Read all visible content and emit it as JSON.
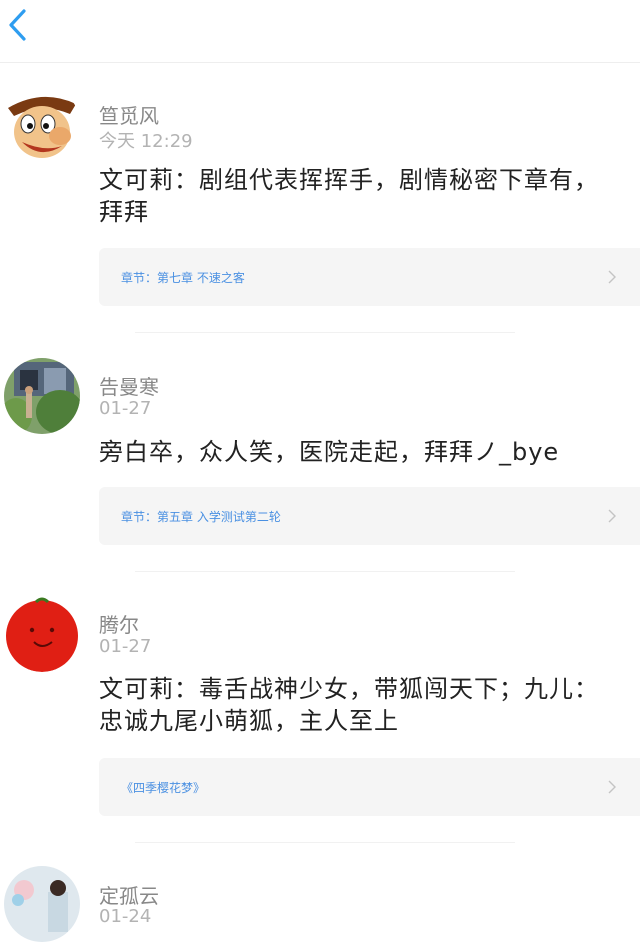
{
  "nav": {
    "back_icon": "chevron-left-icon",
    "accent": "#2e9df0"
  },
  "posts": [
    {
      "name": "笪觅风",
      "time": "今天 12:29",
      "content": "文可莉：剧组代表挥挥手，剧情秘密下章有，拜拜",
      "ref": "章节：第七章  不速之客"
    },
    {
      "name": "告曼寒",
      "time": "01-27",
      "content": "旁白卒，众人笑，医院走起，拜拜ノ_bye",
      "ref": "章节：第五章  入学测试第二轮"
    },
    {
      "name": "腾尔",
      "time": "01-27",
      "content": "文可莉：毒舌战神少女，带狐闯天下；九儿：忠诚九尾小萌狐，主人至上",
      "ref": "《四季樱花梦》"
    },
    {
      "name": "定孤云",
      "time": "01-24"
    }
  ]
}
